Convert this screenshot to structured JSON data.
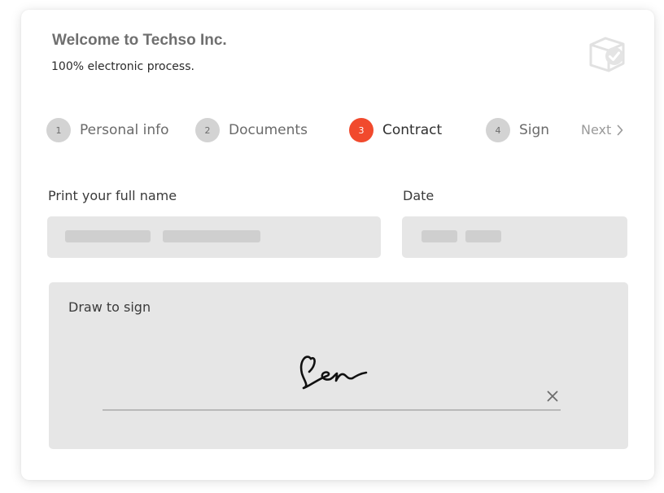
{
  "header": {
    "title": "Welcome to Techso Inc.",
    "subtitle": "100% electronic process.",
    "brand_icon": "box-check-icon"
  },
  "stepper": {
    "steps": [
      {
        "number": "1",
        "label": "Personal info",
        "state": "inactive"
      },
      {
        "number": "2",
        "label": "Documents",
        "state": "inactive"
      },
      {
        "number": "3",
        "label": "Contract",
        "state": "active"
      },
      {
        "number": "4",
        "label": "Sign",
        "state": "inactive"
      }
    ],
    "next_label": "Next",
    "next_icon": "chevron-right-icon"
  },
  "form": {
    "full_name_label": "Print your full name",
    "date_label": "Date",
    "signature_label": "Draw to sign",
    "clear_icon": "close-icon"
  },
  "colors": {
    "accent": "#f14a2d",
    "step_inactive": "#d3d3d3",
    "field_background": "#e6e6e6",
    "placeholder": "#cfcfcf"
  }
}
